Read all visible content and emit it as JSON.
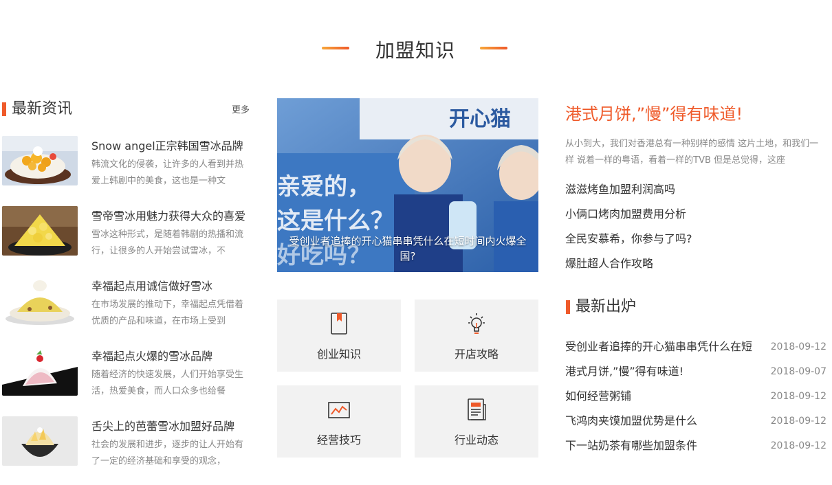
{
  "section": {
    "title": "加盟知识"
  },
  "left": {
    "heading": "最新资讯",
    "more": "更多",
    "items": [
      {
        "title": "Snow angel正宗韩国雪冰品牌",
        "desc": "韩流文化的侵袭，让许多的人看到并热爱上韩剧中的美食，这也是一种文"
      },
      {
        "title": "雪帝雪冰用魅力获得大众的喜爱",
        "desc": "雪冰这种形式，是随着韩剧的热播和流行，让很多的人开始尝试雪冰，不"
      },
      {
        "title": "幸福起点用诚信做好雪冰",
        "desc": "在市场发展的推动下，幸福起点凭借着优质的产品和味道，在市场上受到"
      },
      {
        "title": "幸福起点火爆的雪冰品牌",
        "desc": "随着经济的快速发展，人们开始享受生活，热爱美食，而人口众多也给餐"
      },
      {
        "title": "舌尖上的芭蕾雪冰加盟好品牌",
        "desc": "社会的发展和进步，逐步的让人开始有了一定的经济基础和享受的观念，"
      }
    ]
  },
  "center": {
    "hero_caption": "受创业者追捧的开心猫串串凭什么在短时间内火爆全国?",
    "hero_sign": "开心猫",
    "hero_text_1": "亲爱的，",
    "hero_text_2": "这是什么？",
    "hero_text_3": "好吃吗？",
    "tiles": [
      {
        "label": "创业知识",
        "icon": "bookmark-book-icon"
      },
      {
        "label": "开店攻略",
        "icon": "lightbulb-icon"
      },
      {
        "label": "经营技巧",
        "icon": "line-chart-icon"
      },
      {
        "label": "行业动态",
        "icon": "news-document-icon"
      }
    ]
  },
  "right": {
    "featured_title": "港式月饼,”慢”得有味道!",
    "featured_desc": "从小到大，我们对香港总有一种别样的感情 这片土地，和我们一样 说着一样的粤语，看着一样的TVB 但是总觉得，这座",
    "links": [
      "滋滋烤鱼加盟利润高吗",
      "小俩口烤肉加盟费用分析",
      "全民安慕希，你参与了吗?",
      "爆肚超人合作攻略"
    ],
    "latest_heading": "最新出炉",
    "latest": [
      {
        "title": "受创业者追捧的开心猫串串凭什么在短",
        "date": "2018-09-12"
      },
      {
        "title": "港式月饼,”慢”得有味道!",
        "date": "2018-09-07"
      },
      {
        "title": "如何经营粥铺",
        "date": "2018-09-12"
      },
      {
        "title": "飞鸿肉夹馍加盟优势是什么",
        "date": "2018-09-12"
      },
      {
        "title": "下一站奶茶有哪些加盟条件",
        "date": "2018-09-12"
      }
    ]
  },
  "colors": {
    "accent": "#ef5a2a",
    "accent_light": "#f7a73a",
    "tile_bg": "#f2f2f2"
  }
}
